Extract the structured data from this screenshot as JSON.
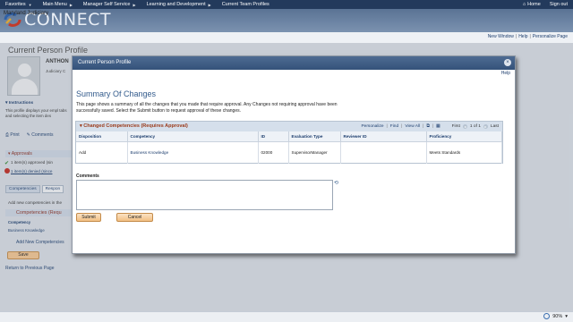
{
  "topnav": {
    "items": [
      "Favorites",
      "Main Menu",
      "Manager Self Service",
      "Learning and Development",
      "Current Team Profiles"
    ],
    "home": "Home",
    "signout": "Sign out"
  },
  "brand": {
    "name": "CONNECT",
    "sub": "Maryland Judiciary"
  },
  "pagelinks": {
    "new_window": "New Window",
    "help": "Help",
    "personalize": "Personalize Page"
  },
  "background": {
    "title": "Current Person Profile",
    "name": "ANTHON",
    "subtitle": "Judiciary C",
    "instructions_label": "Instructions",
    "instructions_text": "This profile displays your empl tabs and selecting the item des",
    "print": "Print",
    "comments": "Comments",
    "approvals": "Approvals",
    "approved": "1 item(s) approved (sin",
    "denied": "1 item(s) denied (since",
    "tabs": [
      "Competencies",
      "Respon"
    ],
    "add_new_text": "Add new competencies in the",
    "comp_header": "Competencies (Requ",
    "comp_label": "Competency",
    "comp_value": "Business Knowledge",
    "add_comp": "Add New Competencies",
    "save": "Save",
    "return": "Return to Previous Page"
  },
  "modal": {
    "title": "Current Person Profile",
    "help": "Help",
    "heading": "Summary Of Changes",
    "description": "This page shows a summary of all the changes that you made that require approval. Any Changes not requiring approval have been successfully saved. Select the Submit button to request approval of these changes.",
    "grid": {
      "caption": "Changed Competencies (Requires Approval)",
      "nav": {
        "personalize": "Personalize",
        "find": "Find",
        "view_all": "View All",
        "first": "First",
        "range": "1 of 1",
        "last": "Last"
      },
      "columns": [
        "Disposition",
        "Competency",
        "ID",
        "Evaluation Type",
        "Reviewer ID",
        "Proficiency"
      ],
      "rows": [
        {
          "disposition": "Add",
          "competency": "Business Knowledge",
          "id": "02000",
          "evaluation_type": "SupervisorManager",
          "reviewer_id": "",
          "proficiency": "Meets Standards"
        }
      ]
    },
    "comments_label": "Comments",
    "comments_value": "",
    "submit": "Submit",
    "cancel": "Cancel"
  },
  "status": {
    "zoom": "90%"
  }
}
